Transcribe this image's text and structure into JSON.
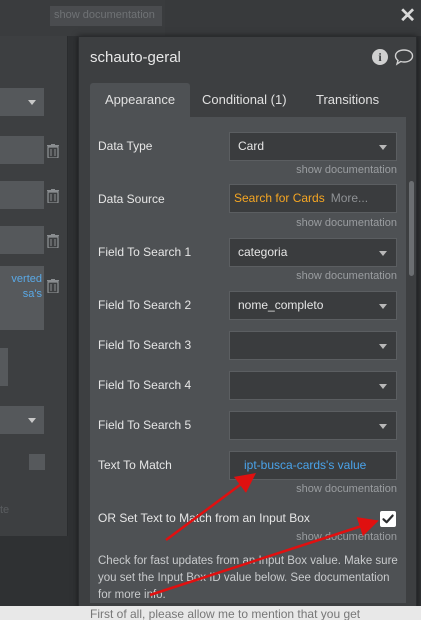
{
  "background": {
    "hint_text": "show documentation",
    "bottom_text": "First of all, please allow me to mention that you get"
  },
  "left_panel": {
    "text_lines": [
      "verted",
      "sa's"
    ],
    "faint_text": "te"
  },
  "panel": {
    "title": "schauto-geral",
    "tabs": [
      {
        "label": "Appearance"
      },
      {
        "label": "Conditional (1)"
      },
      {
        "label": "Transitions"
      }
    ],
    "show_doc_label": "show documentation",
    "fields": {
      "data_type": {
        "label": "Data Type",
        "value": "Card"
      },
      "data_source": {
        "label": "Data Source",
        "value": "Search for Cards",
        "more": "More..."
      },
      "field1": {
        "label": "Field To Search 1",
        "value": "categoria"
      },
      "field2": {
        "label": "Field To Search 2",
        "value": "nome_completo"
      },
      "field3": {
        "label": "Field To Search 3",
        "value": ""
      },
      "field4": {
        "label": "Field To Search 4",
        "value": ""
      },
      "field5": {
        "label": "Field To Search 5",
        "value": ""
      },
      "text_to_match": {
        "label": "Text To Match",
        "value": "ipt-busca-cards's value"
      },
      "input_box_option": {
        "label": "OR Set Text to Match from an Input Box",
        "checked": true
      }
    },
    "help_text": "Check for fast updates from an Input Box value. Make sure you set the Input Box ID value below. See documentation for more info."
  },
  "colors": {
    "accent_orange": "#f5a623",
    "accent_blue": "#4aa3ea",
    "annotation_red": "#e01010",
    "panel_bg": "#3d3f41"
  },
  "icons": [
    "close-icon",
    "info-icon",
    "comment-icon",
    "trash-icon",
    "checkmark-icon",
    "dropdown-chevron-icon"
  ]
}
